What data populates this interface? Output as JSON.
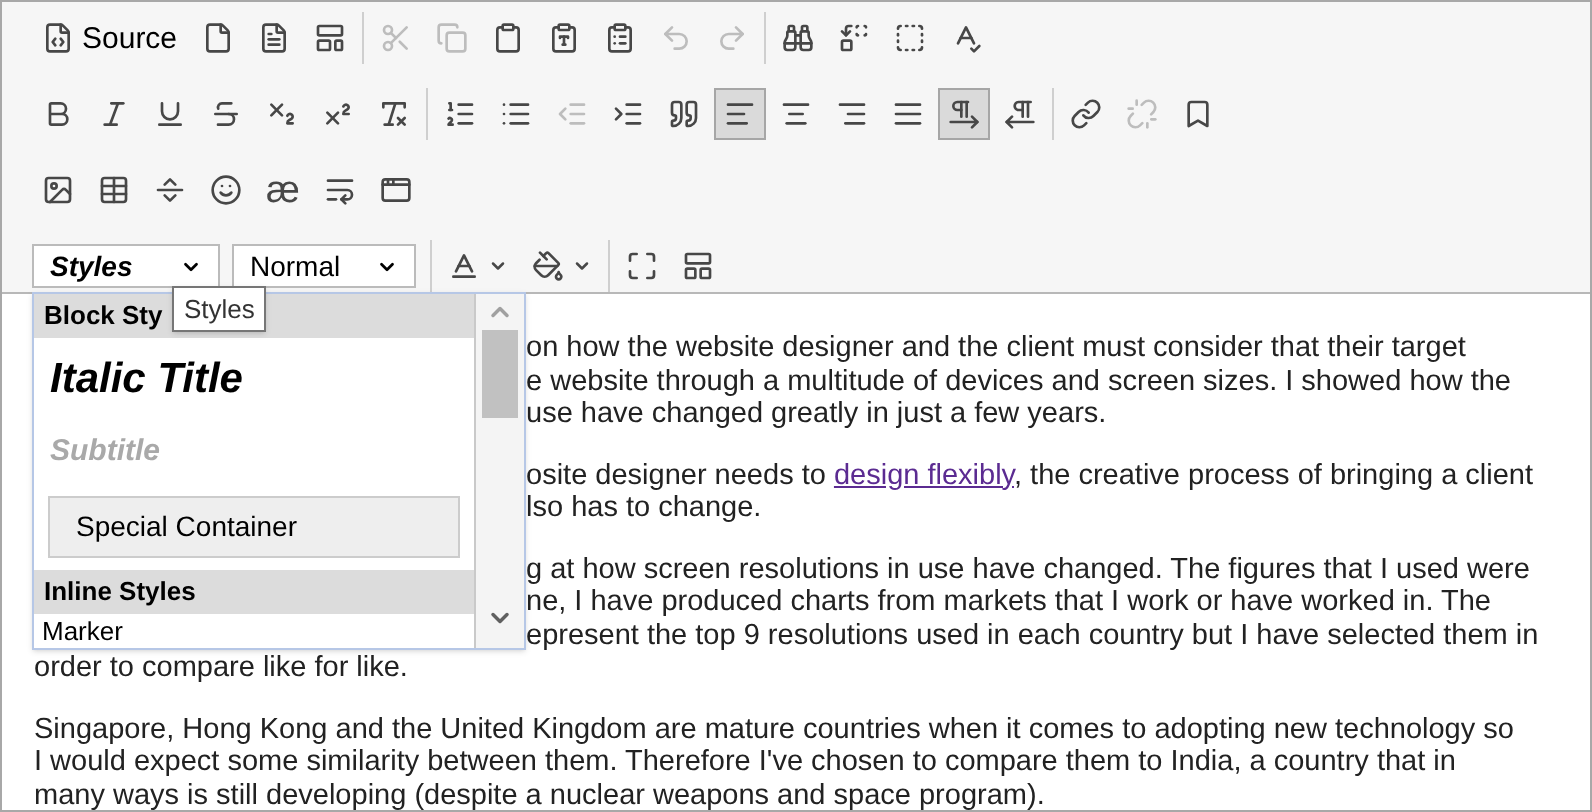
{
  "toolbars": [
    [
      [
        {
          "kind": "button",
          "label": "Source",
          "disabled": false,
          "selected": false
        },
        {
          "kind": "button",
          "disabled": false,
          "selected": false
        },
        {
          "kind": "button",
          "disabled": false,
          "selected": false
        },
        {
          "kind": "button",
          "disabled": false,
          "selected": false
        }
      ],
      [
        {
          "kind": "button",
          "disabled": true,
          "selected": false
        },
        {
          "kind": "button",
          "disabled": true,
          "selected": false
        },
        {
          "kind": "button",
          "disabled": false,
          "selected": false
        },
        {
          "kind": "button",
          "disabled": false,
          "selected": false
        },
        {
          "kind": "button",
          "disabled": false,
          "selected": false
        },
        {
          "kind": "button",
          "disabled": true,
          "selected": false
        },
        {
          "kind": "button",
          "disabled": true,
          "selected": false
        }
      ],
      [
        {
          "kind": "button",
          "disabled": false,
          "selected": false
        },
        {
          "kind": "button",
          "disabled": false,
          "selected": false
        },
        {
          "kind": "button",
          "disabled": false,
          "selected": false
        },
        {
          "kind": "button",
          "disabled": false,
          "selected": false
        }
      ]
    ],
    [
      [
        {
          "kind": "button",
          "disabled": false,
          "selected": false
        },
        {
          "kind": "button",
          "disabled": false,
          "selected": false
        },
        {
          "kind": "button",
          "disabled": false,
          "selected": false
        },
        {
          "kind": "button",
          "disabled": false,
          "selected": false
        },
        {
          "kind": "button",
          "disabled": false,
          "selected": false
        },
        {
          "kind": "button",
          "disabled": false,
          "selected": false
        },
        {
          "kind": "button",
          "disabled": false,
          "selected": false
        }
      ],
      [
        {
          "kind": "button",
          "disabled": false,
          "selected": false
        },
        {
          "kind": "button",
          "disabled": false,
          "selected": false
        },
        {
          "kind": "button",
          "disabled": true,
          "selected": false
        },
        {
          "kind": "button",
          "disabled": false,
          "selected": false
        },
        {
          "kind": "button",
          "disabled": false,
          "selected": false
        },
        {
          "kind": "button",
          "disabled": false,
          "selected": true
        },
        {
          "kind": "button",
          "disabled": false,
          "selected": false
        },
        {
          "kind": "button",
          "disabled": false,
          "selected": false
        },
        {
          "kind": "button",
          "disabled": false,
          "selected": false
        },
        {
          "kind": "button",
          "disabled": false,
          "selected": true
        },
        {
          "kind": "button",
          "disabled": false,
          "selected": false
        }
      ],
      [
        {
          "kind": "button",
          "disabled": false,
          "selected": false
        },
        {
          "kind": "button",
          "disabled": true,
          "selected": false
        },
        {
          "kind": "button",
          "disabled": false,
          "selected": false
        }
      ]
    ],
    [
      [
        {
          "kind": "button",
          "disabled": false,
          "selected": false
        },
        {
          "kind": "button",
          "disabled": false,
          "selected": false
        },
        {
          "kind": "button",
          "disabled": false,
          "selected": false
        },
        {
          "kind": "button",
          "disabled": false,
          "selected": false
        },
        {
          "kind": "button",
          "label": "æ",
          "disabled": false,
          "selected": false
        },
        {
          "kind": "button",
          "disabled": false,
          "selected": false
        },
        {
          "kind": "button",
          "disabled": false,
          "selected": false
        }
      ]
    ],
    [
      [
        {
          "kind": "combo",
          "value": "Styles"
        },
        {
          "kind": "combo",
          "value": "Normal"
        }
      ],
      [
        {
          "kind": "button",
          "disabled": false,
          "selected": false
        },
        {
          "kind": "button",
          "disabled": false,
          "selected": false
        }
      ],
      [
        {
          "kind": "button",
          "disabled": false,
          "selected": false
        },
        {
          "kind": "button",
          "disabled": false,
          "selected": false
        }
      ]
    ]
  ],
  "content": [
    {
      "lines": [
        {
          "covered": true,
          "segments": [
            {
              "text": "on how the website designer and the client must consider that their target"
            }
          ]
        },
        {
          "covered": true,
          "segments": [
            {
              "text": "e website through a multitude of devices and screen sizes. I showed how the"
            }
          ]
        },
        {
          "covered": true,
          "segments": [
            {
              "text": "use have changed greatly in just a few years."
            }
          ]
        }
      ]
    },
    {
      "lines": [
        {
          "covered": true,
          "segments": [
            {
              "text": "osite designer needs to "
            },
            {
              "text": "design flexibly",
              "link": true
            },
            {
              "text": ", the creative process of bringing a client"
            }
          ]
        },
        {
          "covered": true,
          "segments": [
            {
              "text": "lso has to change."
            }
          ]
        }
      ]
    },
    {
      "lines": [
        {
          "covered": true,
          "segments": [
            {
              "text": "g at how screen resolutions in use have changed. The figures that I used were"
            }
          ]
        },
        {
          "covered": true,
          "segments": [
            {
              "text": "ne, I have produced charts from markets that I work or have worked in. The"
            }
          ]
        },
        {
          "covered": true,
          "segments": [
            {
              "text": "epresent the top 9 resolutions used in each country but I have selected them in"
            }
          ]
        },
        {
          "covered": false,
          "segments": [
            {
              "text": "order to compare like for like."
            }
          ]
        }
      ]
    },
    {
      "lines": [
        {
          "covered": false,
          "segments": [
            {
              "text": "Singapore, Hong Kong and the United Kingdom are mature countries when it comes to adopting new technology so"
            }
          ]
        },
        {
          "covered": false,
          "segments": [
            {
              "text": "I would expect some similarity between them. Therefore I've chosen to compare them to India, a country that in"
            }
          ]
        },
        {
          "covered": false,
          "segments": [
            {
              "text": "many ways is still developing (despite a nuclear weapons and space program)."
            }
          ]
        }
      ]
    }
  ],
  "styles_panel": {
    "items": [
      {
        "kind": "heading",
        "text": "Block Sty"
      },
      {
        "kind": "italic_title",
        "text": "Italic Title"
      },
      {
        "kind": "subtitle",
        "text": "Subtitle"
      },
      {
        "kind": "container",
        "text": "Special Container"
      },
      {
        "kind": "heading",
        "text": "Inline Styles"
      },
      {
        "kind": "marker",
        "text": "Marker"
      }
    ]
  },
  "tooltip": "Styles"
}
